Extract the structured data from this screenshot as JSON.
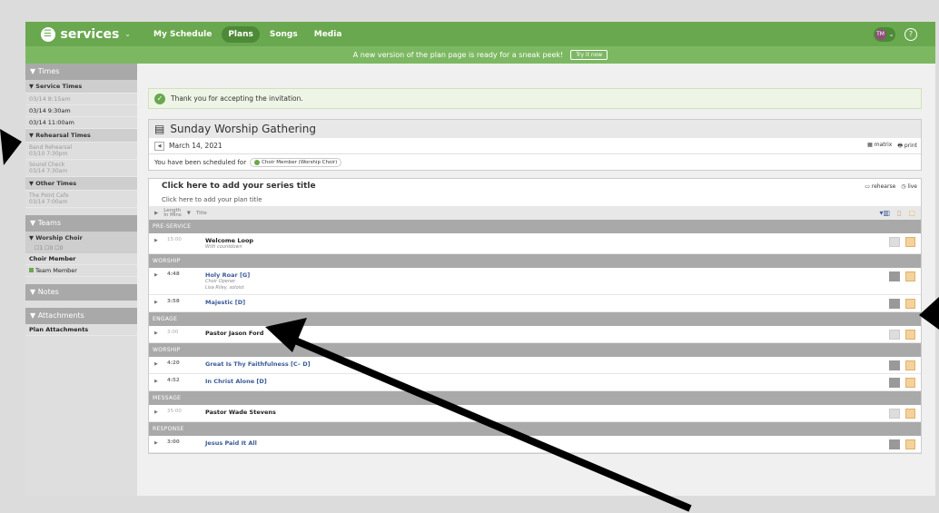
{
  "topbar": {
    "brand": "services",
    "nav": [
      "My Schedule",
      "Plans",
      "Songs",
      "Media"
    ],
    "active_nav": "Plans",
    "user_initials": "TM"
  },
  "banner": {
    "text": "A new version of the plan page is ready for a sneak peek!",
    "button": "Try it now"
  },
  "sidebar": {
    "times_header": "▼ Times",
    "service_times_header": "▼ Service Times",
    "service_times": [
      "03/14 8:15am",
      "03/14 9:30am",
      "03/14 11:00am"
    ],
    "rehearsal_header": "▼ Rehearsal Times",
    "rehearsals": [
      {
        "name": "Band Rehearsal",
        "time": "03/10 7:30pm"
      },
      {
        "name": "Sound Check",
        "time": "03/14 7:30am"
      }
    ],
    "other_header": "▼ Other Times",
    "other": [
      {
        "name": "The Point Cafe",
        "time": "03/14 7:00am"
      }
    ],
    "teams_header": "▼ Teams",
    "team_name": "▼ Worship Choir",
    "team_counts": "☐1 ☐0 ☐0",
    "position": "Choir Member",
    "member": "Team Member",
    "notes_header": "▼ Notes",
    "attachments_header": "▼ Attachments",
    "attachments_item": "Plan Attachments"
  },
  "notice": "Thank you for accepting the invitation.",
  "plan": {
    "title": "Sunday Worship Gathering",
    "date": "March 14, 2021",
    "matrix": "matrix",
    "print": "print",
    "scheduled_text": "You have been scheduled for",
    "scheduled_pill": "Choir Member (Worship Choir)"
  },
  "items": {
    "series_title": "Click here to add your series title",
    "plan_title": "Click here to add your plan title",
    "rehearse": "rehearse",
    "live": "live",
    "col_length": "Length\nIn Mins",
    "col_title": "Title",
    "rows": [
      {
        "section": "PRE-SERVICE"
      },
      {
        "len": "15:00",
        "name": "Welcome Loop",
        "note": "With countdown",
        "song": false,
        "dark_box": false
      },
      {
        "section": "WORSHIP"
      },
      {
        "len": "4:48",
        "name": "Holy Roar [G]",
        "note": "Choir Opener\nLisa Riley, soloist",
        "song": true,
        "dark_box": true
      },
      {
        "len": "3:58",
        "name": "Majestic [D]",
        "song": true,
        "dark_box": true
      },
      {
        "section": "ENGAGE"
      },
      {
        "len": "3:00",
        "name": "Pastor Jason Ford",
        "song": false,
        "dark_box": false
      },
      {
        "section": "WORSHIP"
      },
      {
        "len": "4:20",
        "name": "Great Is Thy Faithfulness [C– D]",
        "song": true,
        "dark_box": true
      },
      {
        "len": "4:52",
        "name": "In Christ Alone [D]",
        "song": true,
        "dark_box": true
      },
      {
        "section": "MESSAGE"
      },
      {
        "len": "35:00",
        "name": "Pastor Wade Stevens",
        "song": false,
        "dark_box": false
      },
      {
        "section": "RESPONSE"
      },
      {
        "len": "3:00",
        "name": "Jesus Paid It All",
        "song": true,
        "dark_box": true
      }
    ]
  },
  "colors": {
    "brand": "#6aa84f",
    "banner": "#7cb862",
    "section": "#a9a9a9",
    "link": "#3a5a99"
  }
}
